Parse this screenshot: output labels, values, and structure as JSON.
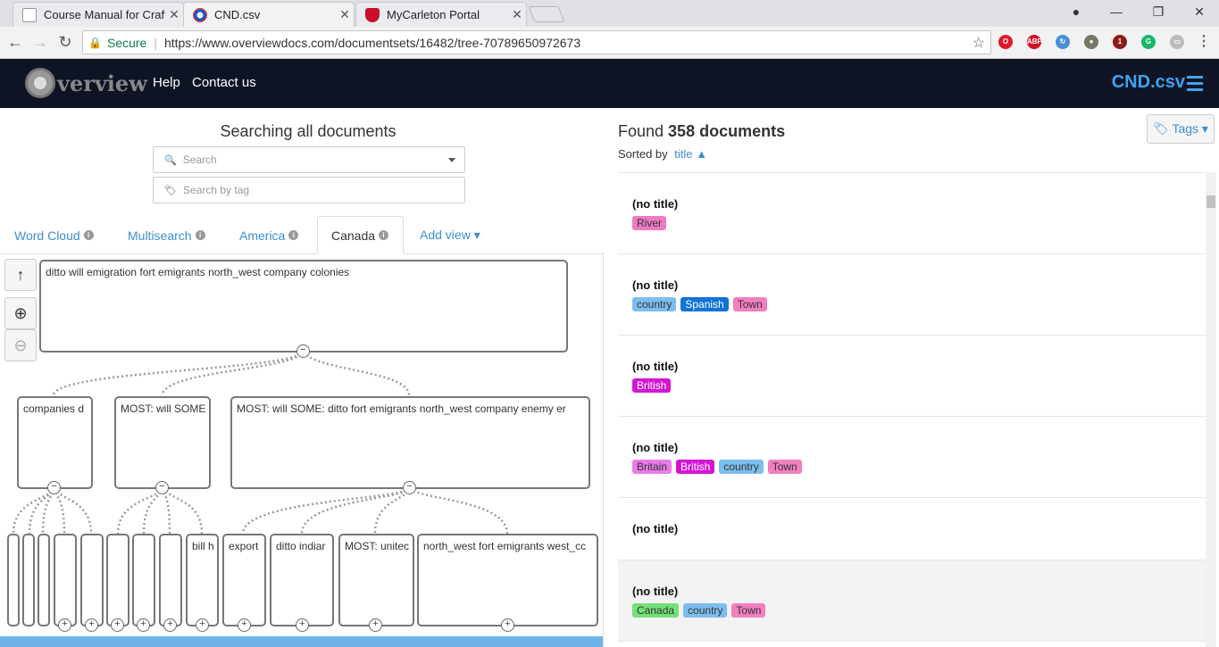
{
  "browser": {
    "tabs": [
      {
        "title": "Course Manual for Craftir",
        "close": "✕",
        "fav_color": "#ffffff"
      },
      {
        "title": "CND.csv",
        "close": "✕",
        "fav_color": "#1a56c4"
      },
      {
        "title": "MyCarleton Portal",
        "close": "✕",
        "fav_color": "#c8102e"
      }
    ],
    "window": {
      "account": "●",
      "minimize": "—",
      "maximize": "❐",
      "close": "✕"
    },
    "nav": {
      "back": "←",
      "forward": "→",
      "reload": "↻"
    },
    "address": {
      "lock": "🔒",
      "secure": "Secure",
      "url": "https://www.overviewdocs.com/documentsets/16482/tree-70789650972673",
      "star": "☆"
    },
    "extensions": [
      {
        "name": "opera-icon",
        "color": "#e0142a",
        "text": "O"
      },
      {
        "name": "adblock-icon",
        "color": "#d2102b",
        "text": "ABP"
      },
      {
        "name": "translate-icon",
        "color": "#4a8fdc",
        "text": "↻"
      },
      {
        "name": "shield-extension-icon",
        "color": "#777766",
        "text": "●"
      },
      {
        "name": "ublock-icon",
        "color": "#8a1c1c",
        "text": "1"
      },
      {
        "name": "grammarly-icon",
        "color": "#15b86a",
        "text": "G"
      },
      {
        "name": "cast-icon",
        "color": "#bbbbbb",
        "text": "▭"
      },
      {
        "name": "menu-icon",
        "color": "#666666",
        "text": "⋮"
      }
    ]
  },
  "header": {
    "logo_text": "verview",
    "help": "Help",
    "contact": "Contact us",
    "docset": "CND.csv"
  },
  "search": {
    "title": "Searching all documents",
    "placeholder": "Search",
    "tag_placeholder": "Search by tag",
    "search_icon": "🔍",
    "tag_icon": "🏷"
  },
  "view_tabs": [
    {
      "label": "Word Cloud",
      "info": "i"
    },
    {
      "label": "Multisearch",
      "info": "i"
    },
    {
      "label": "America",
      "info": "i"
    },
    {
      "label": "Canada",
      "info": "i"
    },
    {
      "label": "Add view ▾",
      "info": ""
    }
  ],
  "tree": {
    "controls": {
      "up": "↑",
      "zoom_in": "⊕",
      "zoom_out": "⊖"
    },
    "root": "ditto will emigration fort emigrants north_west company colonies",
    "level1": [
      "companies d",
      "MOST: will  SOME",
      "MOST: will  SOME: ditto fort emigrants north_west company enemy er"
    ],
    "level2": [
      "bill h",
      "export",
      "ditto indiar",
      "MOST: unitec",
      "north_west fort emigrants west_cc"
    ],
    "collapse": "−",
    "expand": "+"
  },
  "results": {
    "found_prefix": "Found ",
    "count": "358 documents",
    "sorted_prefix": "Sorted by",
    "sort_field": "title ▲",
    "tags_button": "🏷 Tags ▾",
    "rows": [
      {
        "title": "(no title)",
        "tags": [
          {
            "label": "River",
            "color": "#f07ac3"
          }
        ]
      },
      {
        "title": "(no title)",
        "tags": [
          {
            "label": "country",
            "color": "#7dbef0"
          },
          {
            "label": "Spanish",
            "color": "#1273d8"
          },
          {
            "label": "Town",
            "color": "#f27fc0"
          }
        ]
      },
      {
        "title": "(no title)",
        "tags": [
          {
            "label": "British",
            "color": "#d515d5"
          }
        ]
      },
      {
        "title": "(no title)",
        "tags": [
          {
            "label": "Britain",
            "color": "#ea7ae8"
          },
          {
            "label": "British",
            "color": "#d515d5"
          },
          {
            "label": "country",
            "color": "#7dbef0"
          },
          {
            "label": "Town",
            "color": "#f27fc0"
          }
        ]
      },
      {
        "title": "(no title)",
        "tags": []
      },
      {
        "title": "(no title)",
        "tags": [
          {
            "label": "Canada",
            "color": "#73e07a"
          },
          {
            "label": "country",
            "color": "#7dbef0"
          },
          {
            "label": "Town",
            "color": "#f27fc0"
          }
        ]
      }
    ]
  }
}
